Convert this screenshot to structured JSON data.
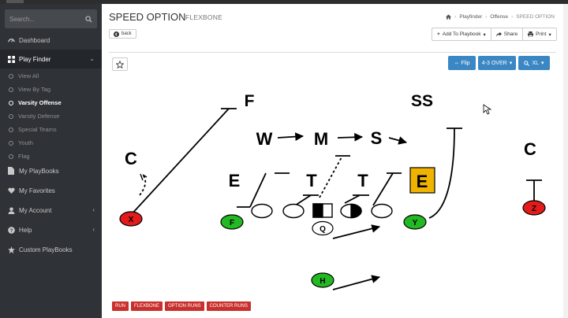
{
  "sidebar": {
    "search_placeholder": "Search...",
    "nav": [
      {
        "label": "Dashboard",
        "icon": "dashboard-icon"
      },
      {
        "label": "Play Finder",
        "icon": "grid-icon"
      },
      {
        "label": "My PlayBooks",
        "icon": "file-icon"
      },
      {
        "label": "My Favorites",
        "icon": "heart-icon"
      },
      {
        "label": "My Account",
        "icon": "user-icon"
      },
      {
        "label": "Help",
        "icon": "question-icon"
      },
      {
        "label": "Custom PlayBooks",
        "icon": "custom-icon"
      }
    ],
    "play_finder_sub": [
      {
        "label": "View All"
      },
      {
        "label": "View By Tag"
      },
      {
        "label": "Varsity Offense"
      },
      {
        "label": "Varsity Defense"
      },
      {
        "label": "Special Teams"
      },
      {
        "label": "Youth"
      },
      {
        "label": "Flag"
      }
    ]
  },
  "header": {
    "title": "SPEED OPTION",
    "subtitle": "FLEXBONE",
    "back_label": "back",
    "breadcrumb": [
      "Playfinder",
      "Offense",
      "SPEED OPTION"
    ]
  },
  "actions": {
    "add_to_playbook": "Add To Playbook",
    "share": "Share",
    "print": "Print"
  },
  "diagram_controls": {
    "flip": "Flip",
    "defense": "4-3 OVER",
    "size": "XL"
  },
  "players": {
    "defense_labels": [
      "F",
      "SS",
      "W",
      "M",
      "S",
      "C",
      "C",
      "E",
      "T",
      "T",
      "E"
    ],
    "offense_labels": [
      "X",
      "F",
      "Y",
      "Z",
      "Q",
      "H"
    ]
  },
  "colors": {
    "sidebar_bg": "#2f3236",
    "accent_blue": "#3a87c4",
    "tag_red": "#c9302c",
    "player_red": "#e31b1b",
    "player_green": "#22b922",
    "end_gold": "#f0b400"
  },
  "tags": [
    "RUN",
    "FLEXBONE",
    "OPTION RUNS",
    "COUNTER RUNS"
  ]
}
